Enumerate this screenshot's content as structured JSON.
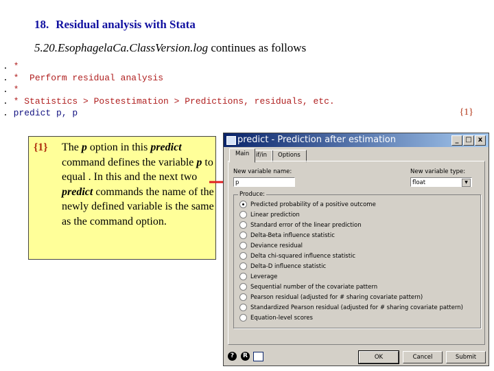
{
  "slide": {
    "number": "18.",
    "title": "Residual analysis with Stata",
    "subtitle_file": "5.20.EsophagelaCa.ClassVersion.log",
    "subtitle_rest": " continues as follows",
    "ref_tag": "{1}"
  },
  "code": [
    {
      "dot": ".",
      "text": " *",
      "kind": "comment"
    },
    {
      "dot": ".",
      "text": " *  Perform residual analysis",
      "kind": "comment"
    },
    {
      "dot": ".",
      "text": " *",
      "kind": "comment"
    },
    {
      "dot": ".",
      "text": " * Statistics > Postestimation > Predictions, residuals, etc.",
      "kind": "comment"
    },
    {
      "dot": ".",
      "text": " predict p, p",
      "kind": "command"
    }
  ],
  "note": {
    "tag": "{1}",
    "t1": "The ",
    "p1": "p",
    "t2": " option in this ",
    "p2": "predict",
    "t3": " command defines the variable ",
    "p3": "p",
    "t4": " to equal   .  In this and the next two ",
    "p4": "predict",
    "t5": " commands the name of the newly defined variable is the same as the command option.",
    "bg": "#ffff99"
  },
  "dialog": {
    "title": "predict - Prediction after estimation",
    "tabs": [
      "Main",
      "if/in",
      "Options"
    ],
    "new_var_label": "New variable name:",
    "new_var_value": "p",
    "type_label": "New variable type:",
    "type_value": "float",
    "group_label": "Produce:",
    "options": [
      "Predicted probability of a positive outcome",
      "Linear prediction",
      "Standard error of the linear prediction",
      "Delta-Beta influence statistic",
      "Deviance residual",
      "Delta chi-squared influence statistic",
      "Delta-D influence statistic",
      "Leverage",
      "Sequential number of the covariate pattern",
      "Pearson residual (adjusted for # sharing covariate pattern)",
      "Standardized Pearson residual (adjusted for # sharing covariate pattern)",
      "Equation-level scores"
    ],
    "selected": 0,
    "buttons": {
      "ok": "OK",
      "cancel": "Cancel",
      "submit": "Submit"
    },
    "help_icons": [
      "?",
      "R"
    ]
  },
  "colors": {
    "title": "#1010a0",
    "comment": "#b02020",
    "command": "#101080",
    "arrow": "#e02020",
    "titlebar": "#0a246a"
  }
}
